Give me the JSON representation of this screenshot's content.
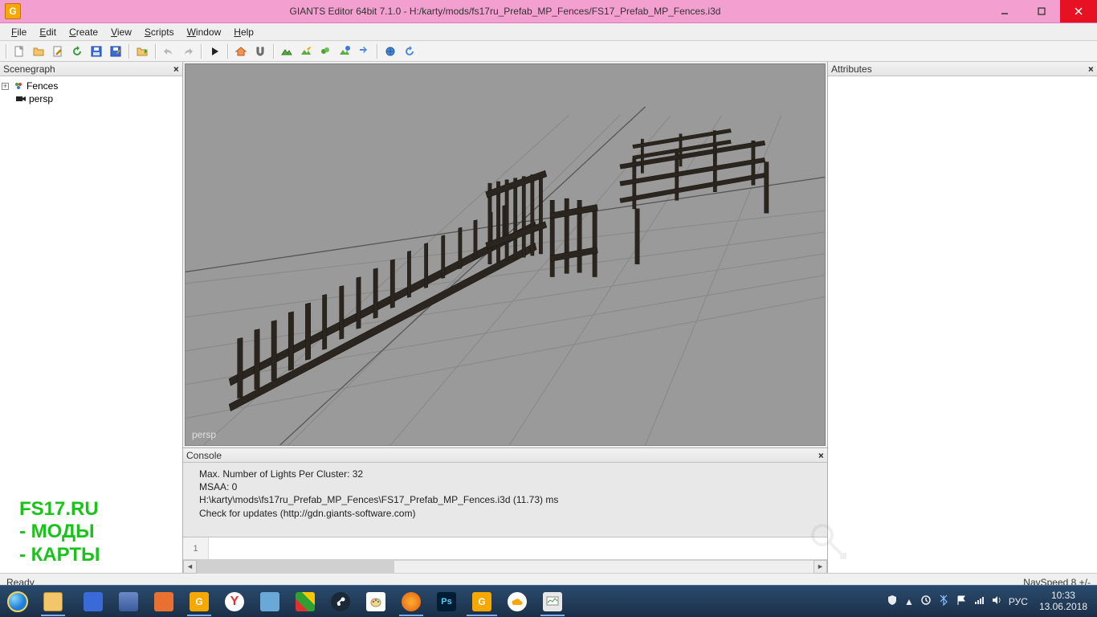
{
  "window": {
    "title": "GIANTS Editor 64bit 7.1.0 - H:/karty/mods/fs17ru_Prefab_MP_Fences/FS17_Prefab_MP_Fences.i3d"
  },
  "menu": {
    "file": "File",
    "edit": "Edit",
    "create": "Create",
    "view": "View",
    "scripts": "Scripts",
    "window": "Window",
    "help": "Help"
  },
  "panels": {
    "scenegraph": "Scenegraph",
    "attributes": "Attributes",
    "console": "Console"
  },
  "tree": {
    "node1": "Fences",
    "node2": "persp"
  },
  "viewport": {
    "camera_label": "persp"
  },
  "console": {
    "line1": "Max. Number of Lights Per Cluster: 32",
    "line2": "MSAA: 0",
    "line3": "H:\\karty\\mods\\fs17ru_Prefab_MP_Fences\\FS17_Prefab_MP_Fences.i3d (11.73) ms",
    "line4": "Check for updates (http://gdn.giants-software.com)",
    "input_line_no": "1"
  },
  "status": {
    "left": "Ready",
    "right": "NavSpeed 8 +/-"
  },
  "tray": {
    "lang": "РУС",
    "time": "10:33",
    "date": "13.06.2018"
  },
  "watermark": {
    "l1": "FS17.RU",
    "l2": "- МОДЫ",
    "l3": "- КАРТЫ"
  }
}
